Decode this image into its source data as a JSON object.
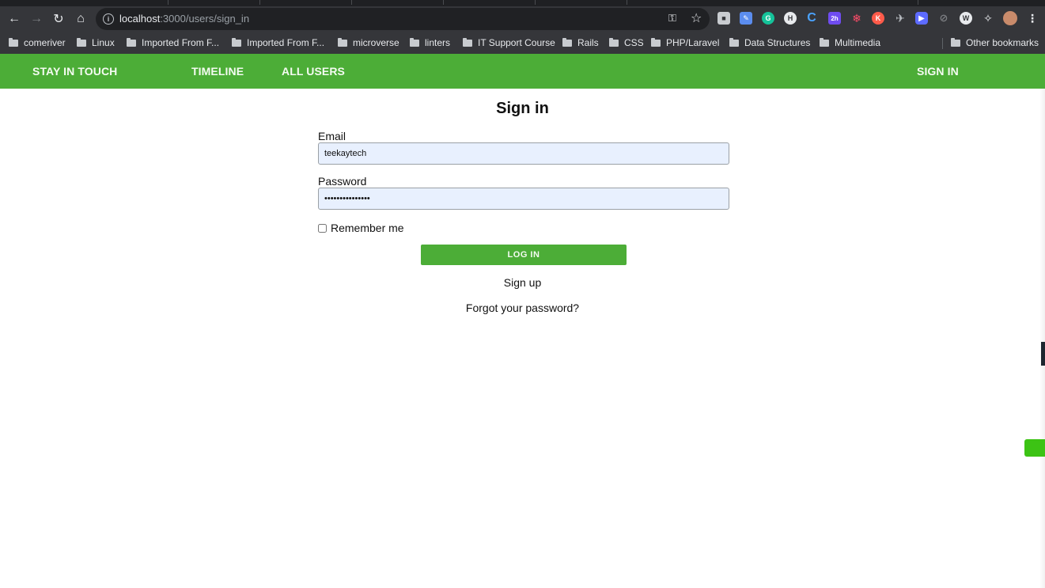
{
  "browser": {
    "url_host": "localhost",
    "url_path": ":3000/users/sign_in",
    "bookmarks": [
      "comeriver",
      "Linux",
      "Imported From F...",
      "Imported From F...",
      "microverse",
      "linters",
      "IT Support Course",
      "Rails",
      "CSS",
      "PHP/Laravel",
      "Data Structures",
      "Multimedia"
    ],
    "other_bookmarks": "Other bookmarks",
    "extension_badge": "2h"
  },
  "nav": {
    "brand": "STAY IN TOUCH",
    "timeline": "TIMELINE",
    "all_users": "ALL USERS",
    "sign_in": "SIGN IN"
  },
  "form": {
    "title": "Sign in",
    "email_label": "Email",
    "email_value": "teekaytech",
    "password_label": "Password",
    "password_value": "teekaytech12345",
    "remember_label": "Remember me",
    "login_label": "LOG IN",
    "signup_link": "Sign up",
    "forgot_link": "Forgot your password?"
  },
  "colors": {
    "accent": "#4cad37",
    "input_bg": "#e8f0fe"
  }
}
